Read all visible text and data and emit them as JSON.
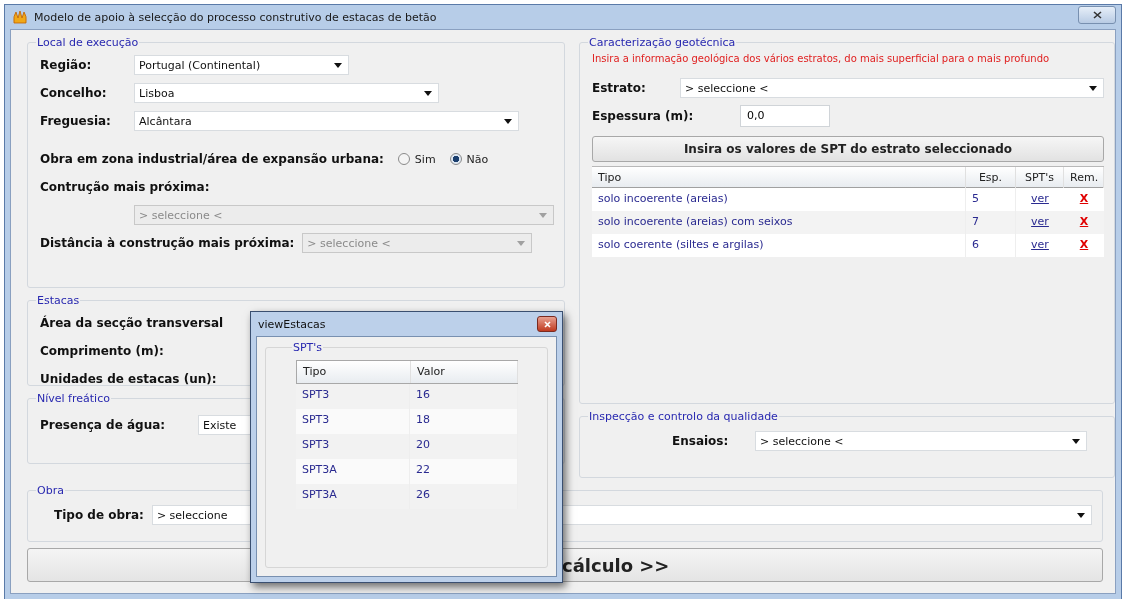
{
  "window": {
    "title": "Modelo de apoio à selecção do processo construtivo de estacas de betão"
  },
  "local": {
    "title": "Local de execução",
    "fields": [
      {
        "kind": "select",
        "label": "Região:",
        "value": "Portugal (Continental)",
        "disabled": false
      },
      {
        "kind": "select",
        "label": "Concelho:",
        "value": "Lisboa",
        "disabled": false
      },
      {
        "kind": "select",
        "label": "Freguesia:",
        "value": "Alcântara",
        "disabled": false
      },
      {
        "kind": "radio",
        "label": "Obra em zona industrial/área de expansão urbana:",
        "options": [
          {
            "label": "Sim",
            "selected": false
          },
          {
            "label": "Não",
            "selected": true
          }
        ]
      },
      {
        "kind": "select_below",
        "label": "Contrução mais próxima:",
        "value": "> seleccione <",
        "disabled": true
      },
      {
        "kind": "select",
        "label": "Distância à construção mais próxima:",
        "value": "> seleccione <",
        "disabled": true
      }
    ]
  },
  "estacas": {
    "title": "Estacas",
    "labels": [
      "Área da secção transversal",
      "Comprimento (m):",
      "Unidades de estacas (un):"
    ]
  },
  "nivel": {
    "title": "Nível freático",
    "label": "Presença de água:",
    "value": "Existe"
  },
  "obra": {
    "title": "Obra",
    "label": "Tipo de obra:",
    "value": "> seleccione"
  },
  "geo": {
    "title": "Caracterização geotécnica",
    "note": "Insira a informação geológica dos vários estratos, do mais superficial para o mais profundo",
    "estrato": {
      "label": "Estrato:",
      "value": "> seleccione <"
    },
    "espessura": {
      "label": "Espessura  (m):",
      "value": "0,0"
    },
    "spt_button": "Insira os valores de SPT do estrato seleccionado",
    "columns": [
      "Tipo",
      "Esp.",
      "SPT's",
      "Rem."
    ],
    "rows": [
      {
        "tipo": "solo incoerente (areias)",
        "esp": "5",
        "link": "ver",
        "remove": "X"
      },
      {
        "tipo": "solo incoerente (areias) com seixos",
        "esp": "7",
        "link": "ver",
        "remove": "X"
      },
      {
        "tipo": "solo coerente (siltes e argilas)",
        "esp": "6",
        "link": "ver",
        "remove": "X"
      }
    ]
  },
  "inspeccao": {
    "title": "Inspecção e controlo da qualidade",
    "label": "Ensaios:",
    "value": "> seleccione <"
  },
  "calc_button": "cálculo >>",
  "dialog": {
    "title": "viewEstacas",
    "group": "SPT's",
    "columns": [
      "Tipo",
      "Valor"
    ],
    "rows": [
      {
        "tipo": "SPT3",
        "valor": "16"
      },
      {
        "tipo": "SPT3",
        "valor": "18"
      },
      {
        "tipo": "SPT3",
        "valor": "20"
      },
      {
        "tipo": "SPT3A",
        "valor": "22"
      },
      {
        "tipo": "SPT3A",
        "valor": "26"
      }
    ]
  }
}
